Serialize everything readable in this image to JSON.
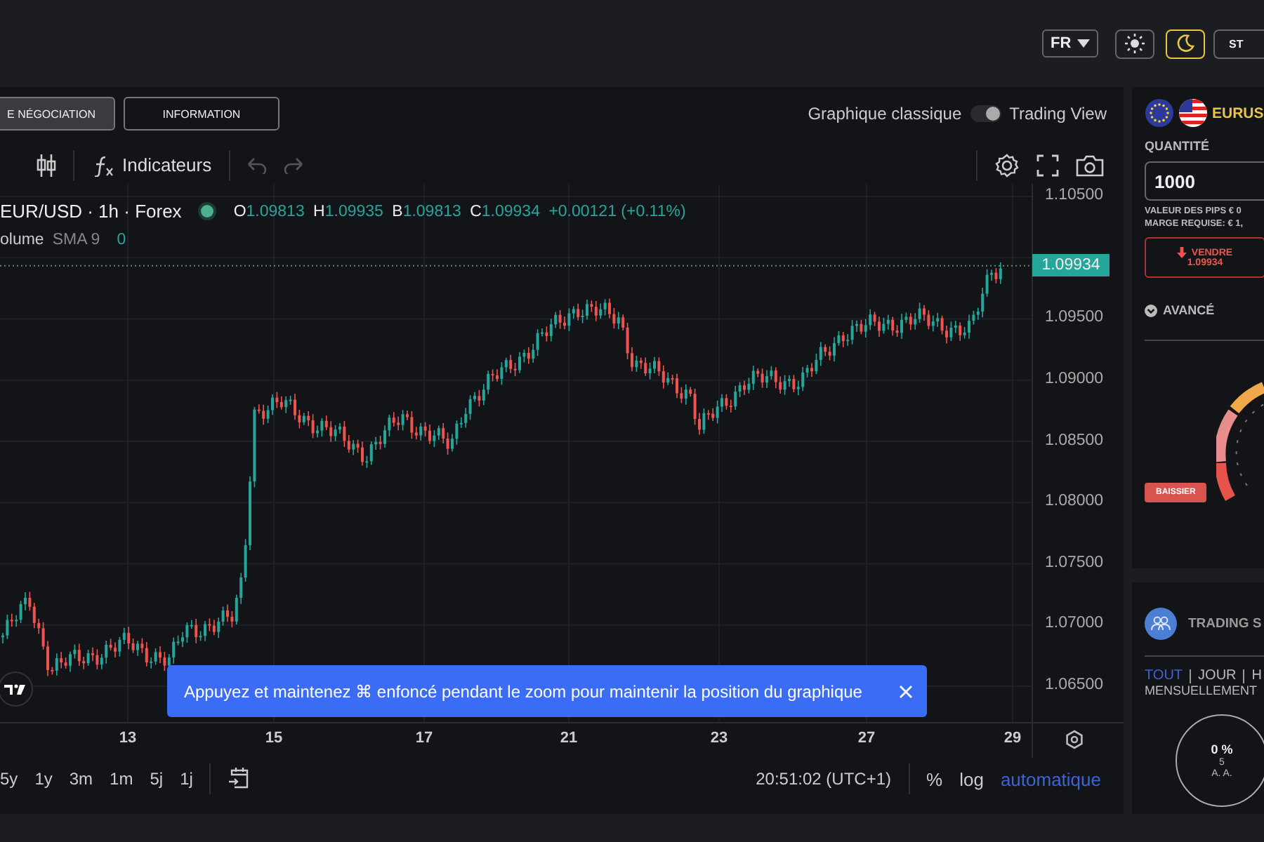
{
  "topbar": {
    "language": "FR",
    "theme_buttons": [
      {
        "kind": "sun",
        "selected": false
      },
      {
        "kind": "moon",
        "selected": true
      }
    ],
    "cut_button": "ST"
  },
  "tabs": [
    {
      "label": "E NÉGOCIATION",
      "selected": true
    },
    {
      "label": "INFORMATION",
      "selected": false
    }
  ],
  "view_toggle": {
    "left_label": "Graphique classique",
    "right_label": "Trading View",
    "on": true
  },
  "toolbar": {
    "indicators": "Indicateurs"
  },
  "legend": {
    "symbol": "EUR/USD · 1h · Forex",
    "ohlc": [
      {
        "label": "O",
        "value": "1.09813"
      },
      {
        "label": "H",
        "value": "1.09935"
      },
      {
        "label": "B",
        "value": "1.09813"
      },
      {
        "label": "C",
        "value": "1.09934"
      }
    ],
    "change": "+0.00121 (+0.11%)",
    "volume": {
      "name": "olume",
      "study": "SMA 9",
      "value": "0"
    }
  },
  "price_axis": [
    "1.10500",
    "1.09500",
    "1.09000",
    "1.08500",
    "1.08000",
    "1.07500",
    "1.07000",
    "1.06500"
  ],
  "last_price": "1.09934",
  "time_axis": [
    "13",
    "15",
    "17",
    "21",
    "23",
    "27",
    "29"
  ],
  "toast": {
    "message": "Appuyez et maintenez ⌘ enfoncé pendant le zoom pour maintenir la position du graphique"
  },
  "ranges": [
    "5y",
    "1y",
    "3m",
    "1m",
    "5j",
    "1j"
  ],
  "status": {
    "time": "20:51:02 (UTC+1)",
    "percent": "%",
    "log": "log",
    "scale": "automatique"
  },
  "order_panel": {
    "symbol": "EURUS",
    "quantity_label": "QUANTITÉ",
    "quantity": "1000",
    "pip_value": "VALEUR DES PIPS € 0",
    "margin": "MARGE REQUISE: € 1,",
    "sell": {
      "label": "VENDRE",
      "price": "1.09934"
    },
    "advanced": "AVANCÉ",
    "sentiment": "BAISSIER"
  },
  "trading_panel": {
    "title": "TRADING S",
    "filters": [
      {
        "label": "TOUT",
        "selected": true
      },
      {
        "label": "JOUR",
        "selected": false
      },
      {
        "label": "H",
        "selected": false
      }
    ],
    "period": "MENSUELLEMENT",
    "stat": {
      "percent": "0 %",
      "count": "5",
      "label": "A. A."
    }
  }
}
